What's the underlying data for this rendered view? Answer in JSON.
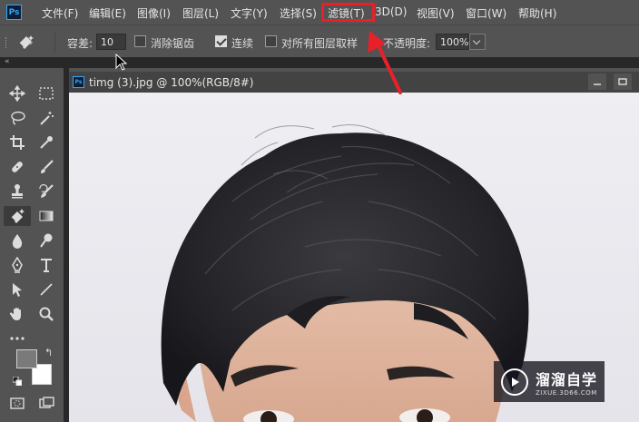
{
  "app": {
    "logo_text": "Ps"
  },
  "menu": {
    "items": [
      {
        "label": "文件(F)"
      },
      {
        "label": "编辑(E)"
      },
      {
        "label": "图像(I)"
      },
      {
        "label": "图层(L)"
      },
      {
        "label": "文字(Y)"
      },
      {
        "label": "选择(S)"
      },
      {
        "label": "滤镜(T)",
        "highlighted": true
      },
      {
        "label": "3D(D)"
      },
      {
        "label": "视图(V)"
      },
      {
        "label": "窗口(W)"
      },
      {
        "label": "帮助(H)"
      }
    ],
    "highlight_color": "#e8202a"
  },
  "options_bar": {
    "tolerance_label": "容差:",
    "tolerance_value": "10",
    "antialias_label": "消除锯齿",
    "antialias_checked": false,
    "contiguous_label": "连续",
    "contiguous_checked": true,
    "sample_all_label": "对所有图层取样",
    "sample_all_checked": false,
    "opacity_label": "不透明度:",
    "opacity_value": "100%"
  },
  "toolbar": {
    "tools": [
      "move-icon",
      "marquee-icon",
      "lasso-icon",
      "magic-wand-icon",
      "crop-icon",
      "eyedropper-icon",
      "healing-brush-icon",
      "brush-icon",
      "clone-stamp-icon",
      "history-brush-icon",
      "eraser-icon",
      "gradient-icon",
      "blur-icon",
      "dodge-icon",
      "pen-icon",
      "type-icon",
      "path-selection-icon",
      "line-icon",
      "hand-icon",
      "zoom-icon",
      "more-tools-icon"
    ],
    "active_tool": "eraser-icon",
    "foreground_color": "#7a7a7a",
    "background_color": "#ffffff"
  },
  "document": {
    "tab_title": "timg (3).jpg @ 100%(RGB/8#)",
    "canvas_bg": "#ecebf0"
  },
  "watermark": {
    "main_text": "溜溜自学",
    "sub_text": "ZIXUE.3D66.COM"
  }
}
